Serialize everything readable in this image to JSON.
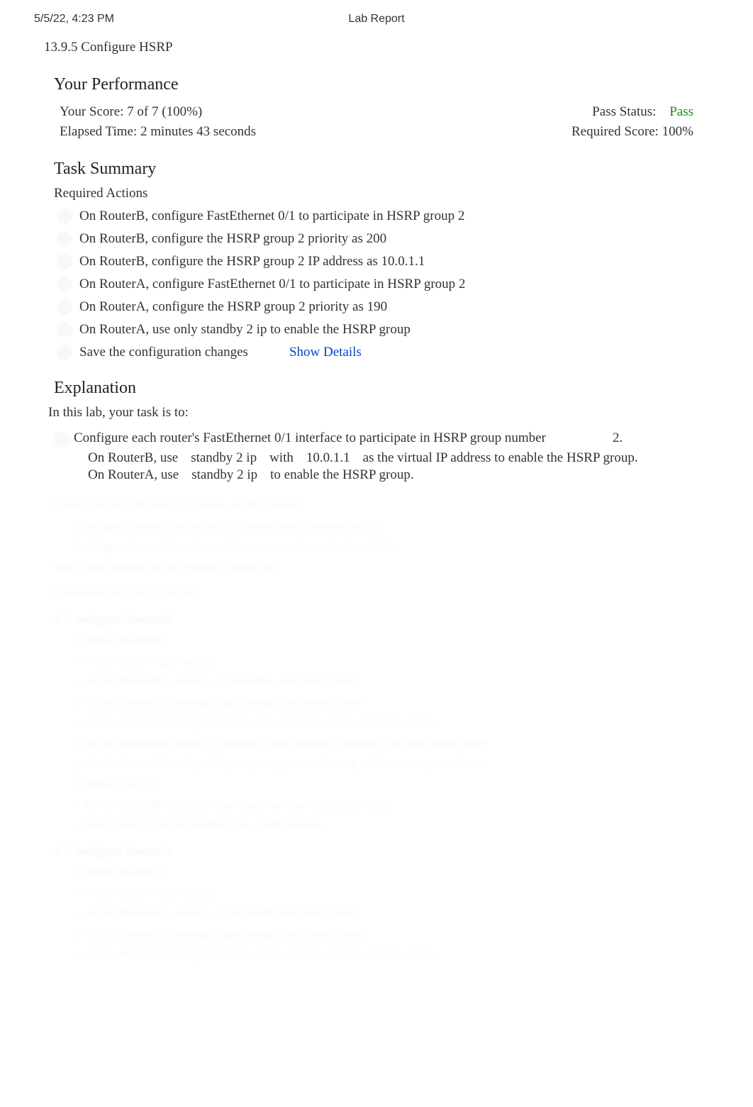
{
  "header": {
    "timestamp": "5/5/22, 4:23 PM",
    "title": "Lab Report"
  },
  "lab": {
    "number_title": "13.9.5 Configure HSRP"
  },
  "performance": {
    "heading": "Your Performance",
    "score_label": "Your Score: 7 of 7 (100%)",
    "pass_status_label": "Pass Status:",
    "pass_status_value": "Pass",
    "elapsed_label": "Elapsed Time: 2 minutes 43 seconds",
    "required_label": "Required Score: 100%"
  },
  "task_summary": {
    "heading": "Task Summary",
    "required_label": "Required Actions",
    "actions": [
      "On RouterB, configure FastEthernet 0/1 to participate in HSRP group 2",
      "On RouterB, configure the HSRP group 2 priority as 200",
      "On RouterB, configure the HSRP group 2 IP address as 10.0.1.1",
      "On RouterA, configure FastEthernet 0/1 to participate in HSRP group 2",
      "On RouterA, configure the HSRP group 2 priority as 190",
      "On RouterA, use only standby 2 ip to enable the HSRP group"
    ],
    "save_action": "Save the configuration changes",
    "show_details": "Show Details"
  },
  "explanation": {
    "heading": "Explanation",
    "intro": "In this lab, your task is to:",
    "bullet1_text": "Configure each router's FastEthernet 0/1 interface to participate in HSRP group number",
    "bullet1_num": "2.",
    "sub_b_prefix": "On RouterB, use",
    "sub_b_cmd": "standby 2 ip",
    "sub_b_with": "with",
    "sub_b_ip": "10.0.1.1",
    "sub_b_rest": "as the virtual IP address to enable the HSRP group.",
    "sub_a_prefix": "On RouterA, use",
    "sub_a_cmd": "standby 2 ip",
    "sub_a_rest": "to enable the HSRP group."
  },
  "faded": {
    "l1": "Configure the following priorities on the routers:",
    "l2": "Configure RouterB as the active router with a priority of 200.",
    "l3": "Configure RouterA as the standby router with a priority of 190.",
    "l4": "Save your changes in the startup-config file.",
    "l5": "Complete this lab as follows:",
    "l6": "1. Configure RouterB.",
    "l7": "a. Select RouterB.",
    "l8": "b. Press Enter to get started.",
    "l9": "c. At the RouterB> prompt, type enable and press Enter.",
    "l10": "d. At the RouterB# prompt, type config t and press Enter.",
    "l11": "e. At the RouterB(config)# prompt, type interface fa0/1 and press Enter.",
    "l12": "f. At the RouterB(config-if)# prompt, type standby 2 priority 200 and press Enter.",
    "l13": "g. At the RouterB(config-if)# prompt, type standby 2 ip 10.0.1.1 and press Enter.",
    "l14": "h. Press Ctrl + Z.",
    "l15": "i. At the RouterB# prompt, type copy run start and press Enter.",
    "l16": "j. Press Enter to begin building the configuration.",
    "l17": "2. Configure RouterA.",
    "l18": "a. Select RouterA.",
    "l19": "b. Press Enter to get started.",
    "l20": "c. At the RouterA> prompt, type enable and press Enter.",
    "l21": "d. At the RouterA# prompt, type config t and press Enter.",
    "l22": "e. At the RouterA(config)# prompt, type interface fa0/1 and press Enter."
  }
}
